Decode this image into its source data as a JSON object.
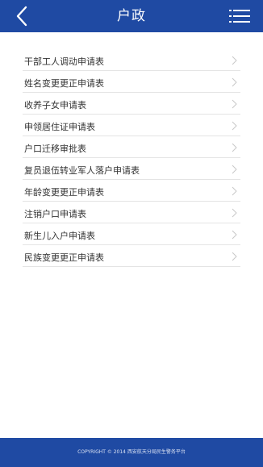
{
  "header": {
    "title": "户政"
  },
  "items": [
    {
      "label": "干部工人调动申请表"
    },
    {
      "label": "姓名变更更正申请表"
    },
    {
      "label": "收养子女申请表"
    },
    {
      "label": "申领居住证申请表"
    },
    {
      "label": "户口迁移审批表"
    },
    {
      "label": "复员退伍转业军人落户申请表"
    },
    {
      "label": "年龄变更更正申请表"
    },
    {
      "label": "注销户口申请表"
    },
    {
      "label": "新生儿入户申请表"
    },
    {
      "label": "民族变更更正申请表"
    }
  ],
  "footer": {
    "copyright": "COPYRIGHT © 2014 西安航天分局民生警务平台"
  },
  "icons": {
    "back": "chevron-left-icon",
    "menu": "menu-icon",
    "item_arrow": "chevron-right-icon"
  },
  "colors": {
    "brand": "#1f4aa3",
    "divider": "#e4e4e4",
    "text": "#333333",
    "chevron": "#c8c8c8"
  }
}
